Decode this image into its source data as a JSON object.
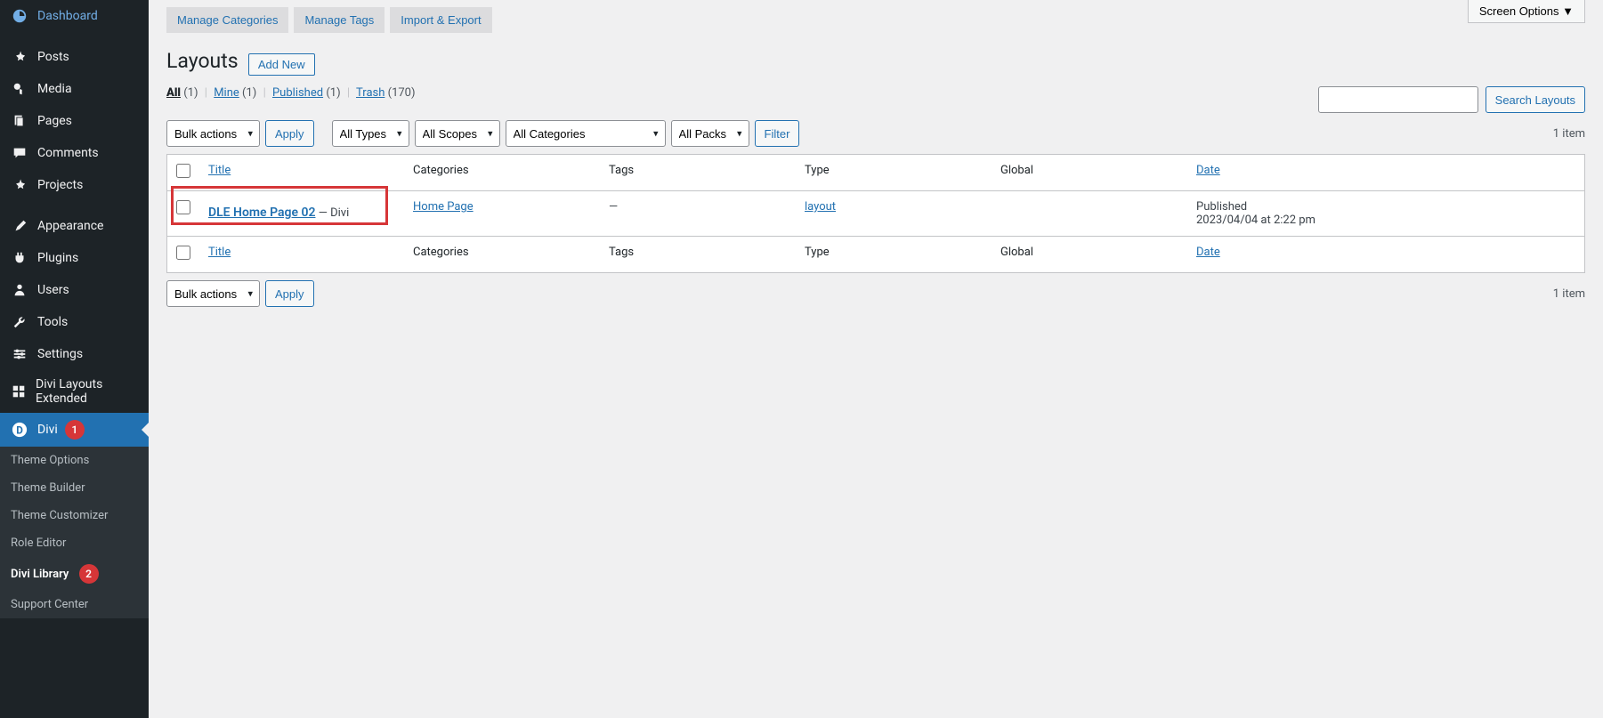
{
  "screen_options_label": "Screen Options",
  "sidebar": {
    "items": [
      {
        "label": "Dashboard",
        "icon": "dashboard"
      },
      {
        "label": "Posts",
        "icon": "pin"
      },
      {
        "label": "Media",
        "icon": "media"
      },
      {
        "label": "Pages",
        "icon": "page"
      },
      {
        "label": "Comments",
        "icon": "comment"
      },
      {
        "label": "Projects",
        "icon": "pin"
      },
      {
        "label": "Appearance",
        "icon": "brush"
      },
      {
        "label": "Plugins",
        "icon": "plug"
      },
      {
        "label": "Users",
        "icon": "user"
      },
      {
        "label": "Tools",
        "icon": "wrench"
      },
      {
        "label": "Settings",
        "icon": "settings"
      },
      {
        "label": "Divi Layouts Extended",
        "icon": "layouts"
      },
      {
        "label": "Divi",
        "icon": "divi",
        "active": true,
        "badge": "1"
      }
    ],
    "submenu": [
      {
        "label": "Theme Options"
      },
      {
        "label": "Theme Builder"
      },
      {
        "label": "Theme Customizer"
      },
      {
        "label": "Role Editor"
      },
      {
        "label": "Divi Library",
        "current": true,
        "badge": "2"
      },
      {
        "label": "Support Center"
      }
    ]
  },
  "top_tabs": [
    {
      "label": "Manage Categories"
    },
    {
      "label": "Manage Tags"
    },
    {
      "label": "Import & Export"
    }
  ],
  "page_title": "Layouts",
  "add_new_label": "Add New",
  "views": {
    "all": {
      "label": "All",
      "count": "(1)"
    },
    "mine": {
      "label": "Mine",
      "count": "(1)"
    },
    "published": {
      "label": "Published",
      "count": "(1)"
    },
    "trash": {
      "label": "Trash",
      "count": "(170)"
    }
  },
  "bulk_actions_label": "Bulk actions",
  "apply_label": "Apply",
  "filters": {
    "types": "All Types",
    "scopes": "All Scopes",
    "categories": "All Categories",
    "packs": "All Packs"
  },
  "filter_label": "Filter",
  "search_label": "Search Layouts",
  "item_count": "1 item",
  "columns": {
    "title": "Title",
    "categories": "Categories",
    "tags": "Tags",
    "type": "Type",
    "global": "Global",
    "date": "Date"
  },
  "row": {
    "title": "DLE Home Page 02",
    "state": " — Divi",
    "category": "Home Page",
    "tags": "—",
    "type": "layout",
    "date_status": "Published",
    "date_value": "2023/04/04 at 2:22 pm"
  }
}
